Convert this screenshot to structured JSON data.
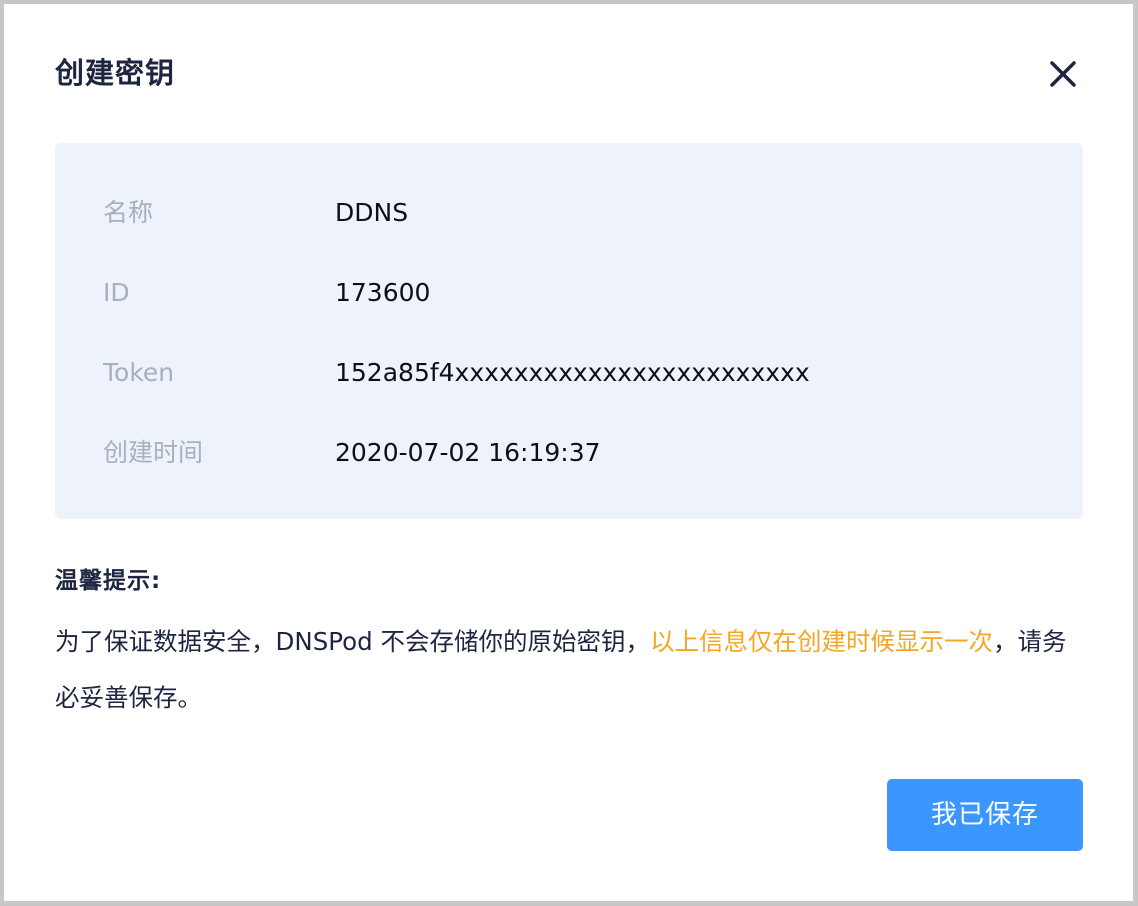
{
  "dialog": {
    "title": "创建密钥",
    "close_icon": "close-icon",
    "info": {
      "name_label": "名称",
      "name_value": "DDNS",
      "id_label": "ID",
      "id_value": "173600",
      "token_label": "Token",
      "token_value": "152a85f4xxxxxxxxxxxxxxxxxxxxxxxx",
      "created_label": "创建时间",
      "created_value": "2020-07-02 16:19:37"
    },
    "tip": {
      "title": "温馨提示:",
      "text_before": "为了保证数据安全，DNSPod 不会存储你的原始密钥，",
      "text_highlight": "以上信息仅在创建时候显示一次",
      "text_after": "，请务必妥善保存。"
    },
    "save_label": "我已保存"
  },
  "colors": {
    "accent": "#3b96ff",
    "warning": "#f5a623",
    "panel_background": "#eef3fb",
    "title_text": "#1e2540",
    "label_text": "#a8b0bf"
  }
}
